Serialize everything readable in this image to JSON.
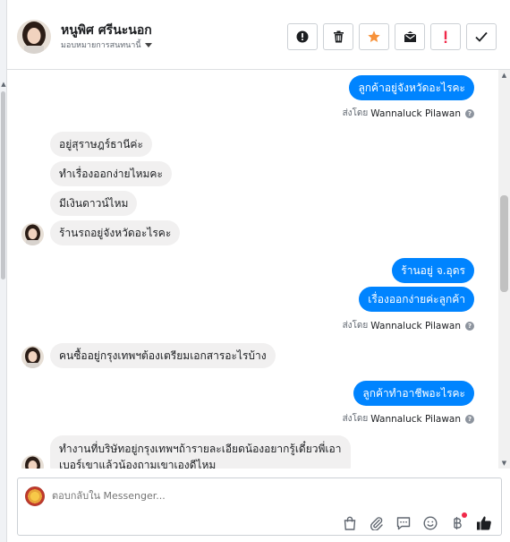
{
  "header": {
    "contact_name": "หนูพิศ ศรีนะนอก",
    "assign_label": "มอบหมายการสนทนานี้",
    "actions": [
      {
        "name": "mark-spam",
        "icon": "exclamation-circle-icon"
      },
      {
        "name": "delete",
        "icon": "trash-icon"
      },
      {
        "name": "star",
        "icon": "star-icon",
        "color": "#f7923a"
      },
      {
        "name": "mark-unread",
        "icon": "envelope-icon"
      },
      {
        "name": "follow-up",
        "icon": "red-exclamation-icon",
        "color": "#f02849"
      },
      {
        "name": "mark-done",
        "icon": "check-icon"
      }
    ]
  },
  "messages": [
    {
      "dir": "out",
      "text": "ลูกค้าอยู่จังหวัดอะไรคะ"
    },
    {
      "sent_by_prefix": "ส่งโดย",
      "sent_by_agent": "Wannaluck Pilawan"
    },
    {
      "dir": "in",
      "text": "อยู่สุราษฎร์ธานีค่ะ"
    },
    {
      "dir": "in",
      "text": "ทำเรื่องออกง่ายไหมคะ"
    },
    {
      "dir": "in",
      "text": "มีเงินดาวน์ไหม"
    },
    {
      "dir": "in",
      "text": "ร้านรถอยู่จังหวัดอะไรคะ"
    },
    {
      "dir": "out",
      "text": "ร้านอยู่ จ.อุดร"
    },
    {
      "dir": "out",
      "text": "เรื่องออกง่ายค่ะลูกค้า"
    },
    {
      "sent_by_prefix": "ส่งโดย",
      "sent_by_agent": "Wannaluck Pilawan"
    },
    {
      "dir": "in",
      "text": "คนซื้ออยู่กรุงเทพฯต้องเตรียมเอกสารอะไรบ้าง"
    },
    {
      "dir": "out",
      "text": "ลูกค้าทำอาชีพอะไรคะ"
    },
    {
      "sent_by_prefix": "ส่งโดย",
      "sent_by_agent": "Wannaluck Pilawan"
    },
    {
      "dir": "in",
      "text": "ทำงานที่บริษัทอยู่กรุงเทพฯถ้ารายละเอียดน้องอยากรู้เดี๋ยวพี่เอาเบอร์เขาแล้วน้องถามเขาเองดีไหม"
    }
  ],
  "composer": {
    "placeholder": "ตอบกลับใน Messenger...",
    "tools": [
      "shopping-bag-icon",
      "paperclip-icon",
      "quick-reply-icon",
      "emoji-icon",
      "baht-payment-icon",
      "thumbs-up-icon"
    ]
  },
  "colors": {
    "accent": "#0084ff",
    "incoming_bubble": "#f1f0f0",
    "alert_red": "#f02849",
    "star_orange": "#f7923a"
  }
}
